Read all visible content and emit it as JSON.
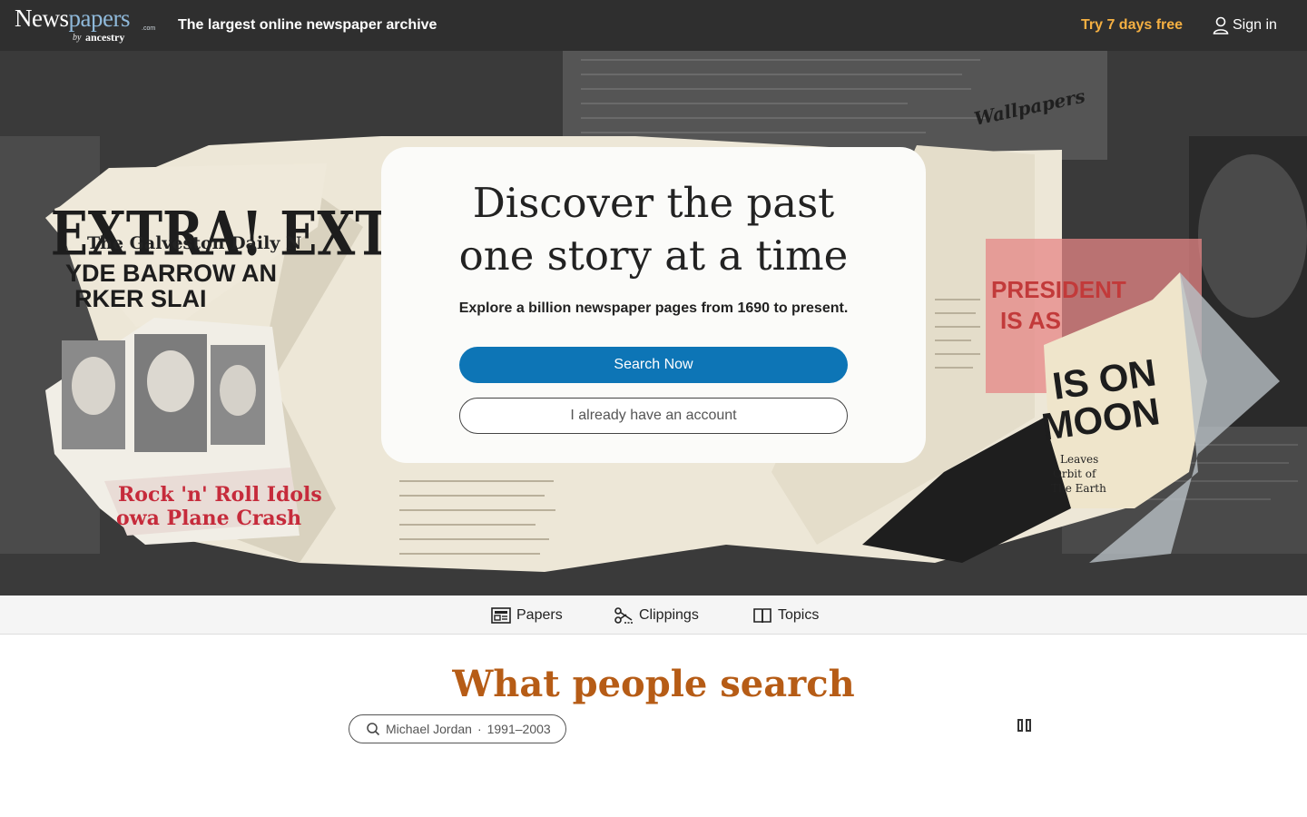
{
  "header": {
    "logo_word_a": "News",
    "logo_word_b": "papers",
    "logo_com": ".com",
    "logo_by": "by",
    "logo_brand": "ancestry",
    "tagline": "The largest online newspaper archive",
    "trial_label": "Try 7 days free",
    "signin_label": "Sign in"
  },
  "hero": {
    "title_line1": "Discover the past",
    "title_line2": "one story at a time",
    "subtitle": "Explore a billion newspaper pages from 1690 to present.",
    "primary_cta": "Search Now",
    "secondary_cta": "I already have an account",
    "collage_text": {
      "extra": "EXTRA! EXTRA!",
      "galveston": "The Galveston Daily N",
      "barrow": "YDE BARROW AN",
      "parker": "RKER SLAI",
      "rock": "Rock 'n' Roll Idols",
      "crash": "owa Plane Crash",
      "wallpapers": "Wallpapers",
      "president": "PRESIDENT",
      "is_as": "IS AS",
      "is_on": "IS ON",
      "moon": "MOON",
      "leaves": "Leaves",
      "orbit": "Orbit of",
      "earth": "The Earth"
    }
  },
  "nav": {
    "items": [
      {
        "label": "Papers",
        "icon": "newspaper-icon"
      },
      {
        "label": "Clippings",
        "icon": "scissors-icon"
      },
      {
        "label": "Topics",
        "icon": "book-icon"
      }
    ]
  },
  "popular": {
    "title": "What people search",
    "chip_name": "Michael Jordan",
    "chip_sep": "·",
    "chip_years": "1991–2003",
    "pause_icon": "pause-icon"
  },
  "colors": {
    "header_bg": "#2f2f2f",
    "trial": "#f5b042",
    "primary": "#0d75b6",
    "section_title": "#b65c16"
  }
}
